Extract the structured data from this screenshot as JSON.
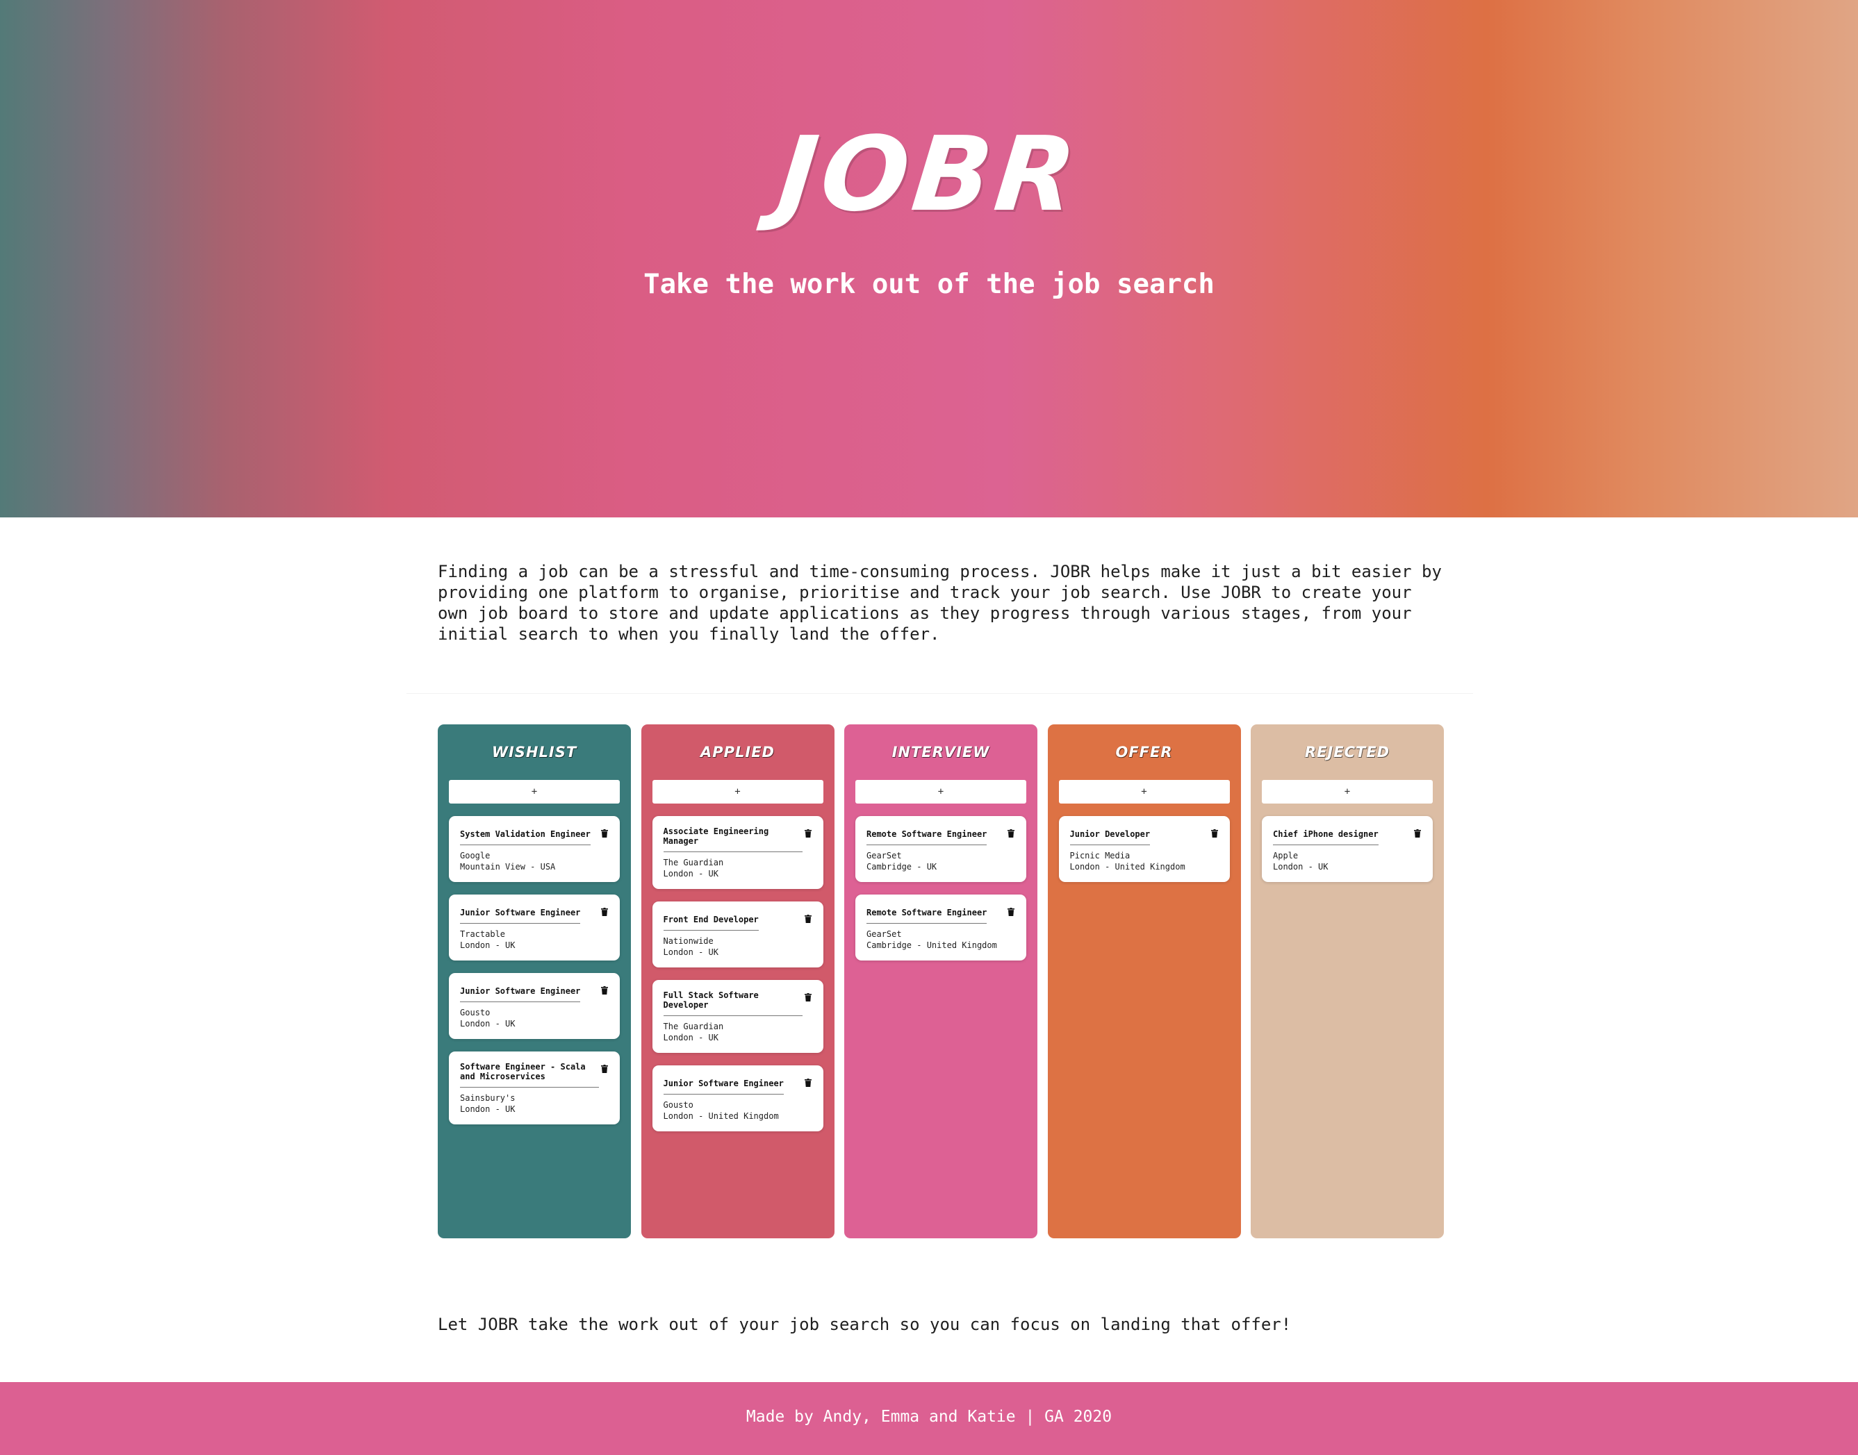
{
  "hero": {
    "brand": "JOBR",
    "tagline": "Take the work out of the job search"
  },
  "intro": {
    "text": "Finding a job can be a stressful and time-consuming process. JOBR helps make it just a bit easier by providing one platform to organise, prioritise and track your job search. Use JOBR to create your own job board to store and update applications as they progress through various stages, from your initial search to when you finally land the offer."
  },
  "board": {
    "add_label": "+",
    "delete_icon": "trash-icon",
    "columns": [
      {
        "title": "WISHLIST",
        "color": "#3a7b7b",
        "cards": [
          {
            "title": "System Validation Engineer",
            "company": "Google",
            "location": "Mountain View - USA"
          },
          {
            "title": "Junior Software Engineer",
            "company": "Tractable",
            "location": "London - UK"
          },
          {
            "title": "Junior Software Engineer",
            "company": "Gousto",
            "location": "London - UK"
          },
          {
            "title": "Software Engineer - Scala and Microservices",
            "company": "Sainsbury's",
            "location": "London - UK"
          }
        ]
      },
      {
        "title": "APPLIED",
        "color": "#d15a6a",
        "cards": [
          {
            "title": "Associate Engineering Manager",
            "company": "The Guardian",
            "location": "London - UK"
          },
          {
            "title": "Front End Developer",
            "company": "Nationwide",
            "location": "London - UK"
          },
          {
            "title": "Full Stack Software Developer",
            "company": "The Guardian",
            "location": "London - UK"
          },
          {
            "title": "Junior Software Engineer",
            "company": "Gousto",
            "location": "London - United Kingdom"
          }
        ]
      },
      {
        "title": "INTERVIEW",
        "color": "#dd6194",
        "cards": [
          {
            "title": "Remote Software Engineer",
            "company": "GearSet",
            "location": "Cambridge - UK"
          },
          {
            "title": "Remote Software Engineer",
            "company": "GearSet",
            "location": "Cambridge - United Kingdom"
          }
        ]
      },
      {
        "title": "OFFER",
        "color": "#dd7244",
        "cards": [
          {
            "title": "Junior Developer",
            "company": "Picnic Media",
            "location": "London - United Kingdom"
          }
        ]
      },
      {
        "title": "REJECTED",
        "color": "#dcbda4",
        "cards": [
          {
            "title": "Chief iPhone designer",
            "company": "Apple",
            "location": "London - UK"
          }
        ]
      }
    ]
  },
  "cta": {
    "text": "Let JOBR take the work out of your job search so you can focus on landing that offer!"
  },
  "footer": {
    "text": "Made by Andy, Emma and Katie | GA 2020",
    "color": "#dc6092"
  }
}
